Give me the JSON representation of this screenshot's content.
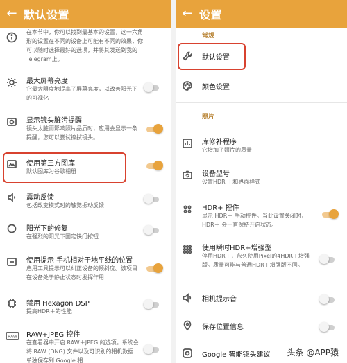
{
  "left": {
    "title": "默认设置",
    "intro": "在本节中，你可以找到最基本的设置，这一六角形的设置在不同的设备上可能有不同的效果，你可以随时选择最好的选项，并将其发送到我的Telegram上。",
    "items": [
      {
        "title": "最大屏幕亮度",
        "subtitle": "它最大限度地提高了屏幕亮度，以改善阳光下的可视化",
        "toggle": "off"
      },
      {
        "title": "显示镜头脏污提醒",
        "subtitle": "镜头太脏而影响照片品质时，应用会显示一条提醒，您可以尝试擦拭镜头。",
        "toggle": "on"
      },
      {
        "title": "使用第三方图库",
        "subtitle": "默认图库为谷歌相册",
        "toggle": "on"
      },
      {
        "title": "震动反馈",
        "subtitle": "包括改变模式时的触觉振动反馈",
        "toggle": "off"
      },
      {
        "title": "阳光下的修复",
        "subtitle": "在强烈的阳光下固定快门按钮",
        "toggle": "off"
      },
      {
        "title": "使用提示 手机相对于地平线的位置",
        "subtitle": "启用工具提示可以纠正设备的倾斜度。该项目在设备处于静止状态时发挥作用",
        "toggle": "on"
      },
      {
        "title": "禁用 Hexagon DSP",
        "subtitle": "提高HDR＋的性能",
        "toggle": "off"
      },
      {
        "title": "RAW+JPEG 控件",
        "subtitle": "在查看器中开启 RAW＋JPEG 的选项。系统会将 RAW (DNG) 文件以及可识别的相机数据单独保存到 Google 相",
        "toggle": "off"
      }
    ]
  },
  "right": {
    "title": "设置",
    "section_general": "常规",
    "section_photo": "照片",
    "items": [
      {
        "title": "默认设置",
        "subtitle": ""
      },
      {
        "title": "颜色设置",
        "subtitle": ""
      },
      {
        "title": "库修补程序",
        "subtitle": "它增加了照片的质量"
      },
      {
        "title": "设备型号",
        "subtitle": "设置HDR ＋和界面样式"
      },
      {
        "title": "HDR+ 控件",
        "subtitle": "显示 HDR＋ 手动控件。当此设置关闭时，HDR＋ 会一直保持开启状态。",
        "toggle": "on"
      },
      {
        "title": "使用瞬时HDR+增强型",
        "subtitle": "停用HDR＋，永久使用Pixel的4HDR＋增强版。质量可能与普通HDR＋增强版不同。",
        "toggle": "off"
      },
      {
        "title": "相机提示音",
        "subtitle": "",
        "toggle": "off"
      },
      {
        "title": "保存位置信息",
        "subtitle": "",
        "toggle": "off"
      },
      {
        "title": "Google 智能镜头建议",
        "subtitle": ""
      }
    ]
  },
  "watermark": "头条 @APP猿",
  "colors": {
    "accent": "#e8a33c",
    "highlight": "#d8422f"
  }
}
